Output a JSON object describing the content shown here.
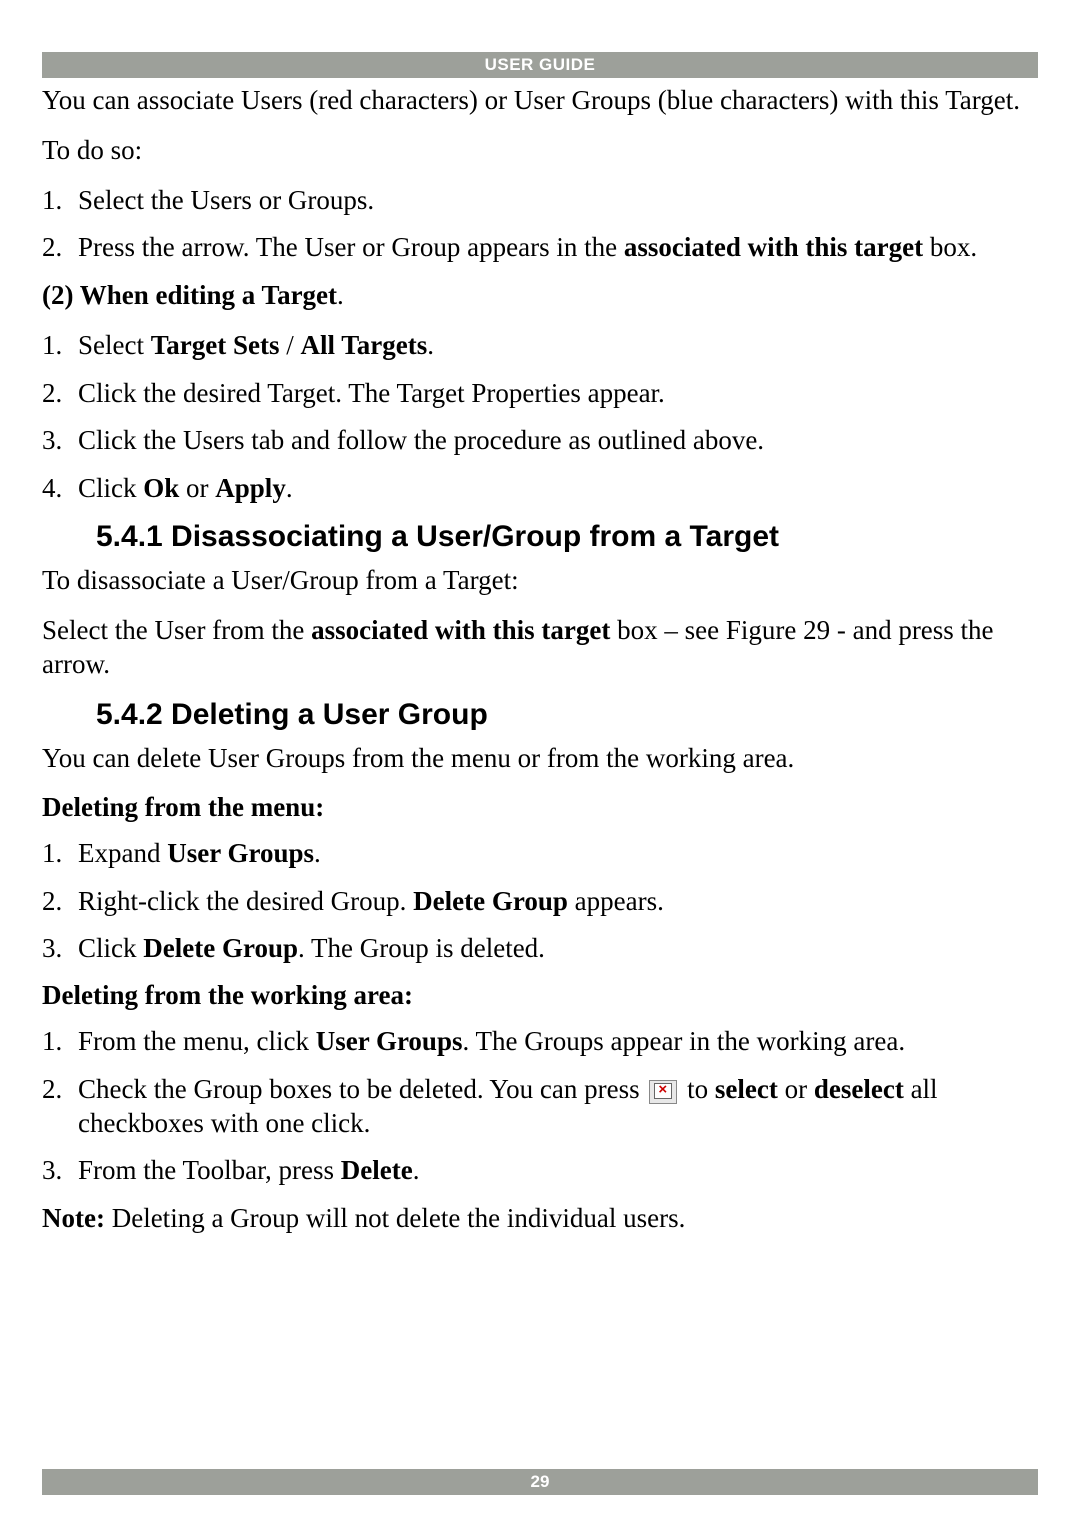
{
  "header": "USER GUIDE",
  "intro1": "You can associate Users (red characters) or User Groups (blue characters) with this Target.",
  "intro2": "To do so:",
  "list1": {
    "i1n": "1.",
    "i1t": "Select the Users or Groups.",
    "i2n": "2.",
    "i2a": "Press the arrow. The User or Group appears in the ",
    "i2b": "associated with this target",
    "i2c": " box."
  },
  "subhead1a": "(2) When editing a Target",
  "subhead1b": ".",
  "list2": {
    "i1n": "1.",
    "i1a": "Select ",
    "i1b": "Target Sets",
    "i1c": " / ",
    "i1d": "All Targets",
    "i1e": ".",
    "i2n": "2.",
    "i2t": "Click the desired Target. The Target Properties appear.",
    "i3n": "3.",
    "i3t": "Click the Users tab and follow the procedure as outlined above.",
    "i4n": "4.",
    "i4a": "Click ",
    "i4b": "Ok",
    "i4c": " or ",
    "i4d": "Apply",
    "i4e": "."
  },
  "h541": "5.4.1 Disassociating a User/Group from a Target",
  "p541a": "To disassociate a User/Group from a Target:",
  "p541b1": "Select the User from the ",
  "p541b2": "associated with this target",
  "p541b3": " box – see Figure 29 - and press the arrow.",
  "h542": "5.4.2 Deleting a User Group",
  "p542a": "You can delete User Groups from the menu or from the working area.",
  "sub542a": "Deleting from the menu:",
  "list3": {
    "i1n": "1.",
    "i1a": "Expand ",
    "i1b": "User Groups",
    "i1c": ".",
    "i2n": "2.",
    "i2a": "Right-click the desired Group. ",
    "i2b": "Delete Group",
    "i2c": " appears.",
    "i3n": "3.",
    "i3a": "Click ",
    "i3b": "Delete Group",
    "i3c": ". The Group is deleted."
  },
  "sub542b": "Deleting from the working area:",
  "list4": {
    "i1n": "1.",
    "i1a": "From the menu, click ",
    "i1b": "User Groups",
    "i1c": ". The Groups appear in the working area.",
    "i2n": "2.",
    "i2a": "Check the Group boxes to be deleted. You can press ",
    "i2b": " to ",
    "i2c": "select",
    "i2d": " or ",
    "i2e": "deselect",
    "i2f": " all checkboxes with one click.",
    "i3n": "3.",
    "i3a": "From the Toolbar, press ",
    "i3b": "Delete",
    "i3c": "."
  },
  "notea": "Note:",
  "noteb": " Deleting a Group will not delete the individual users.",
  "footer": "29"
}
